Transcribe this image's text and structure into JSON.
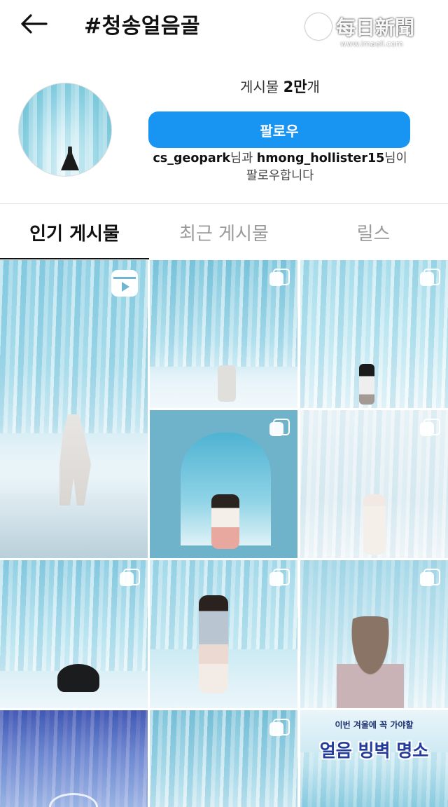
{
  "header": {
    "title": "#청송얼음골",
    "back_icon": "arrow-left-icon",
    "more_icon": "more-vertical-icon"
  },
  "watermark": {
    "name": "每日新聞",
    "url": "www.imaeil.com"
  },
  "profile": {
    "posts_label": "게시물",
    "posts_count": "2만",
    "posts_suffix": "개",
    "follow_label": "팔로우",
    "followed_by": {
      "user1": "cs_geopark",
      "connector": "님과 ",
      "user2": "hmong_hollister15",
      "suffix": "님이 팔로우합니다"
    }
  },
  "tabs": [
    {
      "label": "인기 게시물",
      "active": true
    },
    {
      "label": "최근 게시물",
      "active": false
    },
    {
      "label": "릴스",
      "active": false
    }
  ],
  "grid": {
    "promo_tile": {
      "subtitle": "이번 겨울에 꼭 가야할",
      "title": "얼음 빙벽 명소"
    }
  },
  "colors": {
    "accent": "#1895f3",
    "ice_light": "#dff3f9",
    "ice_mid": "#9ad8e8",
    "ice_deep": "#4ea9c8"
  }
}
